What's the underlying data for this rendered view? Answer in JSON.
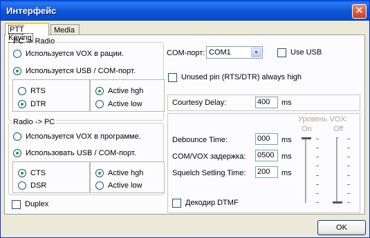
{
  "window": {
    "title": "Интерфейс",
    "close_glyph": "✕"
  },
  "tabs": [
    {
      "label": "PTT Keying",
      "active": true
    },
    {
      "label": "Media",
      "active": false
    }
  ],
  "pc_radio": {
    "title": "PC -> Radio",
    "options": [
      {
        "label": "Используется VOX в рации.",
        "selected": false
      },
      {
        "label": "Используется USB / COM-порт.",
        "selected": true
      }
    ],
    "pins": [
      {
        "label": "RTS",
        "selected": false
      },
      {
        "label": "DTR",
        "selected": true
      }
    ],
    "levels": [
      {
        "label": "Active hgh",
        "selected": true
      },
      {
        "label": "Active low",
        "selected": false
      }
    ]
  },
  "radio_pc": {
    "title": "Radio -> PC",
    "options": [
      {
        "label": "Используется VOX в программе.",
        "selected": false
      },
      {
        "label": "Использовать USB / COM-порт.",
        "selected": true
      }
    ],
    "pins": [
      {
        "label": "CTS",
        "selected": true
      },
      {
        "label": "DSR",
        "selected": false
      }
    ],
    "levels": [
      {
        "label": "Active hgh",
        "selected": true
      },
      {
        "label": "Active low",
        "selected": false
      }
    ]
  },
  "duplex": {
    "label": "Duplex",
    "checked": false
  },
  "com": {
    "label": "COM-порт:",
    "value": "COM1",
    "use_usb": {
      "label": "Use USB",
      "checked": false
    },
    "unused_pin": {
      "label": "Unused pin (RTS/DTR) always high",
      "checked": false
    }
  },
  "courtesy": {
    "label": "Courtesy Delay:",
    "value": "400",
    "unit": "ms"
  },
  "timing": {
    "debounce": {
      "label": "Debounce Time:",
      "value": "000",
      "unit": "ms"
    },
    "com_vox": {
      "label": "COM/VOX задержка:",
      "value": "0500",
      "unit": "ms"
    },
    "squelch": {
      "label": "Squelch Setling Time:",
      "value": "200",
      "unit": "ms"
    },
    "dtmf": {
      "label": "Декодир DTMF",
      "checked": false
    }
  },
  "vox": {
    "title": "Уровень VOX:",
    "on_label": "On",
    "off_label": "Off",
    "on_level": 1.0,
    "off_level": 0.0
  },
  "buttons": {
    "ok": "OK"
  }
}
